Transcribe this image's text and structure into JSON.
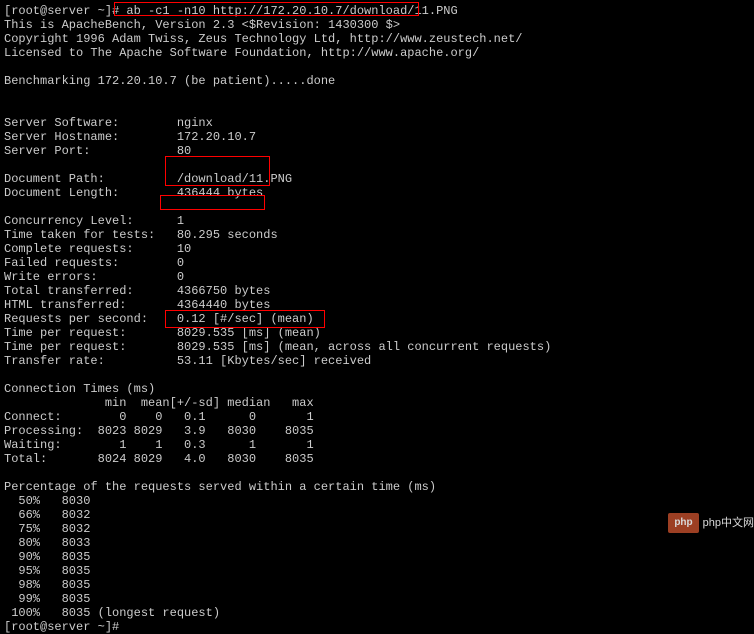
{
  "prompt_line": "[root@server ~]# ab -c1 -n10 http://172.20.10.7/download/11.PNG",
  "header": {
    "l1": "This is ApacheBench, Version 2.3 <$Revision: 1430300 $>",
    "l2": "Copyright 1996 Adam Twiss, Zeus Technology Ltd, http://www.zeustech.net/",
    "l3": "Licensed to The Apache Software Foundation, http://www.apache.org/"
  },
  "benchmark_line": "Benchmarking 172.20.10.7 (be patient).....done",
  "server": {
    "software": "Server Software:        nginx",
    "hostname": "Server Hostname:        172.20.10.7",
    "port": "Server Port:            80"
  },
  "doc": {
    "path": "Document Path:          /download/11.PNG",
    "length": "Document Length:        436444 bytes"
  },
  "results": {
    "concurrency": "Concurrency Level:      1",
    "time_taken": "Time taken for tests:   80.295 seconds",
    "complete": "Complete requests:      10",
    "failed": "Failed requests:        0",
    "write_errors": "Write errors:           0",
    "total_trans": "Total transferred:      4366750 bytes",
    "html_trans": "HTML transferred:       4364440 bytes",
    "rps": "Requests per second:    0.12 [#/sec] (mean)",
    "tpr1": "Time per request:       8029.535 [ms] (mean)",
    "tpr2": "Time per request:       8029.535 [ms] (mean, across all concurrent requests)",
    "transfer": "Transfer rate:          53.11 [Kbytes/sec] received"
  },
  "conn_times": {
    "title": "Connection Times (ms)",
    "header": "              min  mean[+/-sd] median   max",
    "connect": "Connect:        0    0   0.1      0       1",
    "proc": "Processing:  8023 8029   3.9   8030    8035",
    "waiting": "Waiting:        1    1   0.3      1       1",
    "total": "Total:       8024 8029   4.0   8030    8035"
  },
  "pct": {
    "title": "Percentage of the requests served within a certain time (ms)",
    "p50": "  50%   8030",
    "p66": "  66%   8032",
    "p75": "  75%   8032",
    "p80": "  80%   8033",
    "p90": "  90%   8035",
    "p95": "  95%   8035",
    "p98": "  98%   8035",
    "p99": "  99%   8035",
    "p100": " 100%   8035 (longest request)"
  },
  "end_prompt": "[root@server ~]# ",
  "watermark": {
    "badge": "php",
    "text": "php中文网"
  }
}
